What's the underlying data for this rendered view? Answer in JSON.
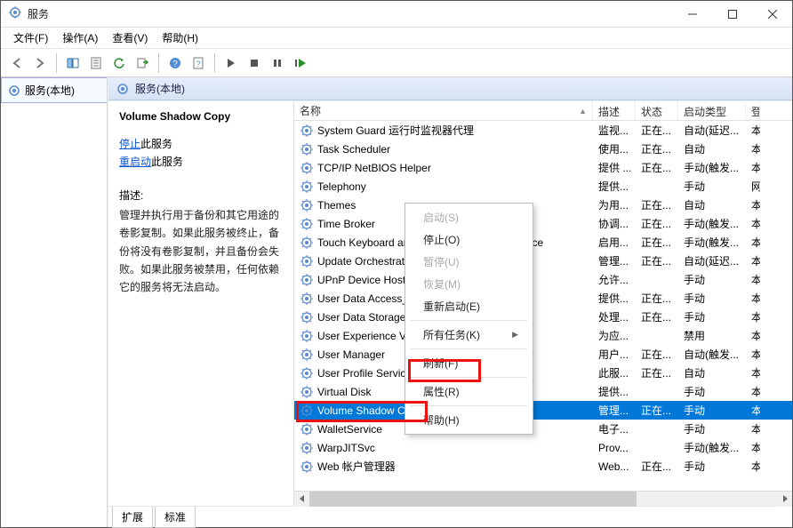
{
  "window": {
    "title": "服务"
  },
  "menus": {
    "file": "文件(F)",
    "action": "操作(A)",
    "view": "查看(V)",
    "help": "帮助(H)"
  },
  "tree": {
    "root": "服务(本地)"
  },
  "caption": "服务(本地)",
  "details": {
    "service_name": "Volume Shadow Copy",
    "link_stop": "停止",
    "link_restart": "重启动",
    "link_suffix": "此服务",
    "desc_label": "描述:",
    "desc_text": "管理并执行用于备份和其它用途的卷影复制。如果此服务被终止，备份将没有卷影复制，并且备份会失败。如果此服务被禁用，任何依赖它的服务将无法启动。"
  },
  "columns": {
    "name": "名称",
    "desc": "描述",
    "state": "状态",
    "start": "启动类型",
    "login": "登"
  },
  "rows": [
    {
      "name": "System Guard 运行时监视器代理",
      "desc": "监视...",
      "state": "正在...",
      "start": "自动(延迟...",
      "login": "本"
    },
    {
      "name": "Task Scheduler",
      "desc": "使用...",
      "state": "正在...",
      "start": "自动",
      "login": "本"
    },
    {
      "name": "TCP/IP NetBIOS Helper",
      "desc": "提供 ...",
      "state": "正在...",
      "start": "手动(触发...",
      "login": "本"
    },
    {
      "name": "Telephony",
      "desc": "提供...",
      "state": "",
      "start": "手动",
      "login": "网"
    },
    {
      "name": "Themes",
      "desc": "为用...",
      "state": "正在...",
      "start": "自动",
      "login": "本"
    },
    {
      "name": "Time Broker",
      "desc": "协调...",
      "state": "正在...",
      "start": "手动(触发...",
      "login": "本"
    },
    {
      "name": "Touch Keyboard and Handwriting Panel Service",
      "desc": "启用...",
      "state": "正在...",
      "start": "手动(触发...",
      "login": "本"
    },
    {
      "name": "Update Orchestrator Service",
      "desc": "管理...",
      "state": "正在...",
      "start": "自动(延迟...",
      "login": "本"
    },
    {
      "name": "UPnP Device Host",
      "desc": "允许...",
      "state": "",
      "start": "手动",
      "login": "本"
    },
    {
      "name": "User Data Access_3d7d7",
      "desc": "提供...",
      "state": "正在...",
      "start": "手动",
      "login": "本"
    },
    {
      "name": "User Data Storage_3d7d7",
      "desc": "处理...",
      "state": "正在...",
      "start": "手动",
      "login": "本"
    },
    {
      "name": "User Experience Virtualization Service",
      "desc": "为应...",
      "state": "",
      "start": "禁用",
      "login": "本"
    },
    {
      "name": "User Manager",
      "desc": "用户...",
      "state": "正在...",
      "start": "自动(触发...",
      "login": "本"
    },
    {
      "name": "User Profile Service",
      "desc": "此服...",
      "state": "正在...",
      "start": "自动",
      "login": "本"
    },
    {
      "name": "Virtual Disk",
      "desc": "提供...",
      "state": "",
      "start": "手动",
      "login": "本"
    },
    {
      "name": "Volume Shadow Copy",
      "desc": "管理...",
      "state": "正在...",
      "start": "手动",
      "login": "本",
      "selected": true
    },
    {
      "name": "WalletService",
      "desc": "电子...",
      "state": "",
      "start": "手动",
      "login": "本"
    },
    {
      "name": "WarpJITSvc",
      "desc": "Prov...",
      "state": "",
      "start": "手动(触发...",
      "login": "本"
    },
    {
      "name": "Web 帐户管理器",
      "desc": "Web...",
      "state": "正在...",
      "start": "手动",
      "login": "本"
    }
  ],
  "context_menu": [
    {
      "label": "启动(S)",
      "enabled": false
    },
    {
      "label": "停止(O)",
      "enabled": true
    },
    {
      "label": "暂停(U)",
      "enabled": false
    },
    {
      "label": "恢复(M)",
      "enabled": false
    },
    {
      "label": "重新启动(E)",
      "enabled": true
    },
    {
      "sep": true
    },
    {
      "label": "所有任务(K)",
      "enabled": true,
      "submenu": true
    },
    {
      "sep": true
    },
    {
      "label": "刷新(F)",
      "enabled": true
    },
    {
      "sep": true
    },
    {
      "label": "属性(R)",
      "enabled": true,
      "highlight": true
    },
    {
      "sep": true
    },
    {
      "label": "帮助(H)",
      "enabled": true
    }
  ],
  "tabs": {
    "extended": "扩展",
    "standard": "标准"
  }
}
